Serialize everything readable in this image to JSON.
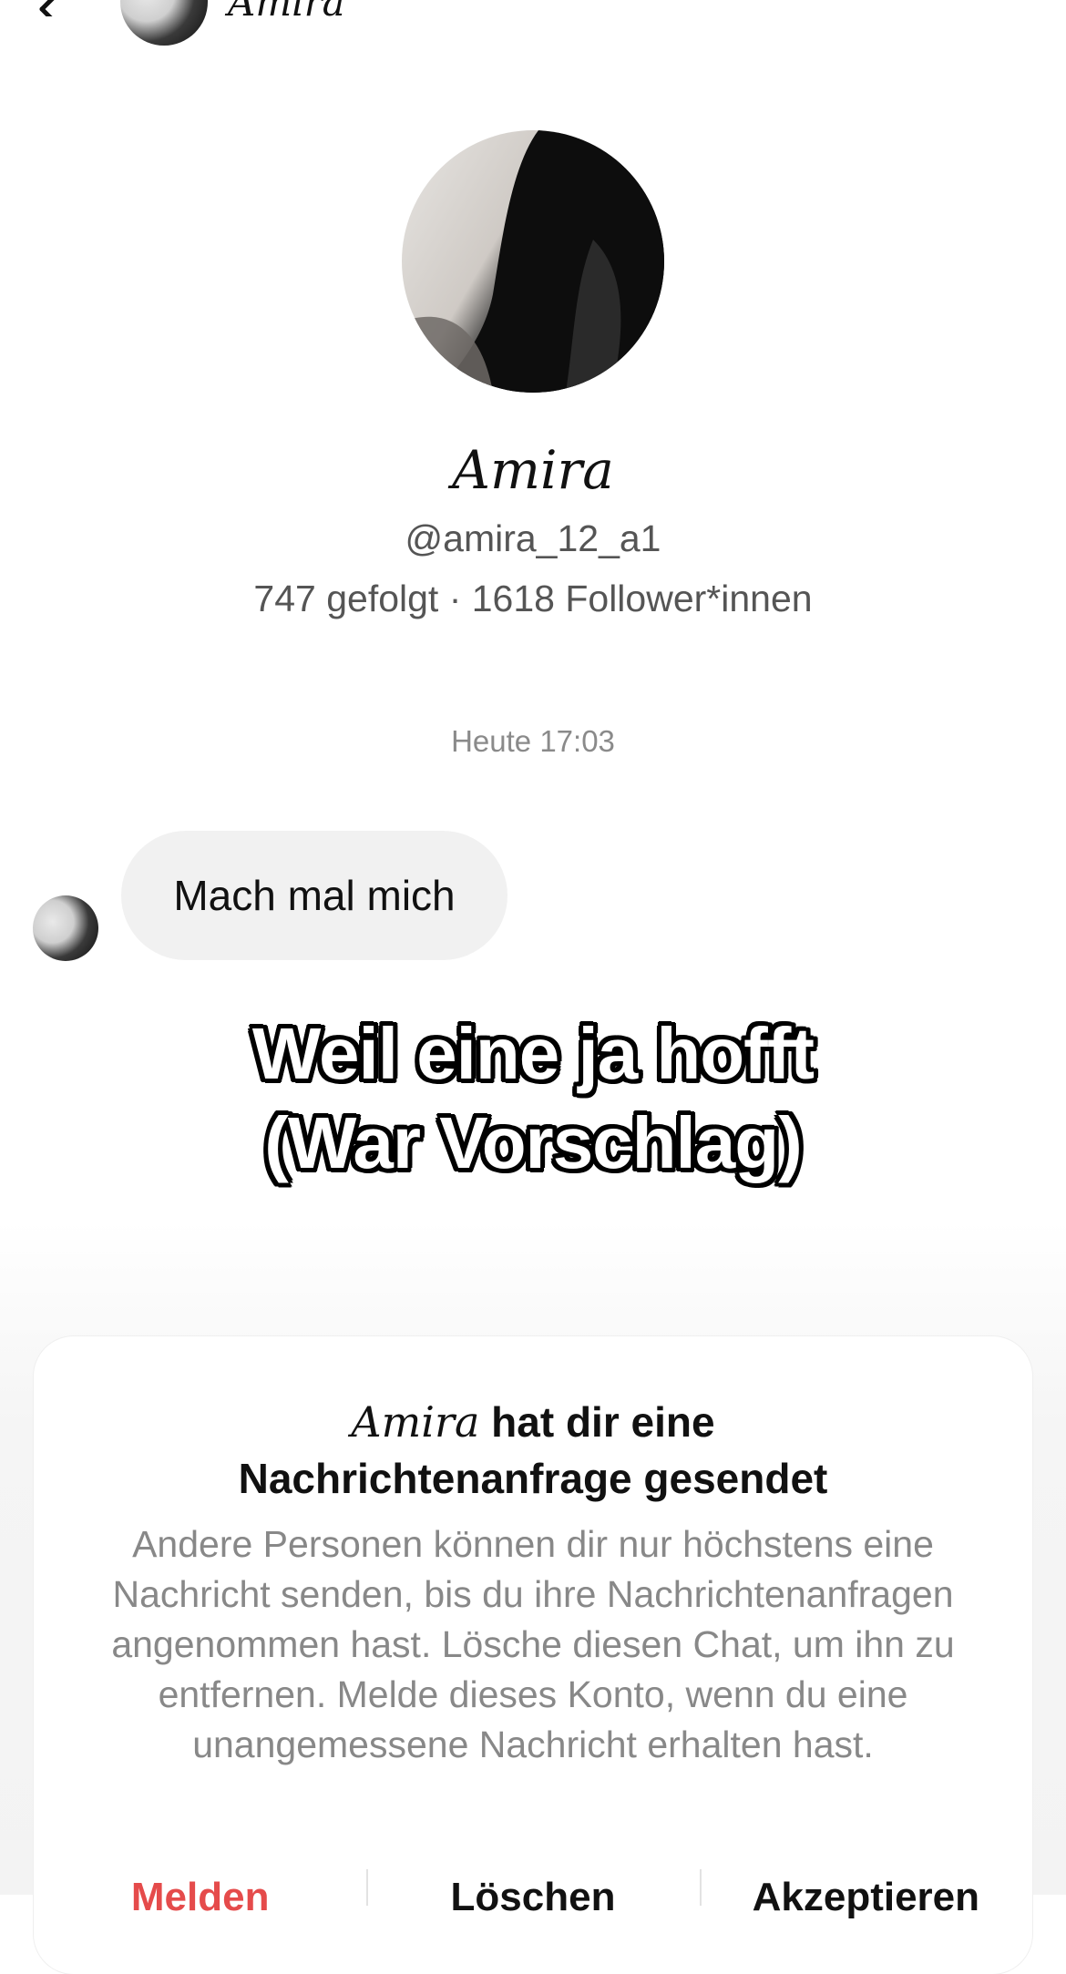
{
  "header": {
    "name": "Amira"
  },
  "profile": {
    "name": "Amira",
    "handle": "@amira_12_a1",
    "stats": "747 gefolgt · 1618 Follower*innen"
  },
  "chat": {
    "timestamp": "Heute 17:03",
    "message": "Mach mal mich"
  },
  "overlay": {
    "line1": "Weil eine ja hofft",
    "line2": "(War Vorschlag)"
  },
  "request": {
    "name": "Amira",
    "title_rest": " hat dir eine",
    "title_line2": "Nachrichtenanfrage gesendet",
    "body": "Andere Personen können dir nur höchstens eine Nachricht senden, bis du ihre Nachrichtenanfragen angenommen hast. Lösche diesen Chat, um ihn zu entfernen. Melde dieses Konto, wenn du eine unangemessene Nachricht erhalten hast.",
    "actions": [
      "Melden",
      "Löschen",
      "Akzeptieren"
    ]
  },
  "icons": {
    "back": "chevron-left-icon",
    "more": "more-horizontal-icon"
  },
  "colors": {
    "danger": "#e54b4b",
    "muted_text": "#888888",
    "bubble_bg": "#f1f1f1"
  }
}
